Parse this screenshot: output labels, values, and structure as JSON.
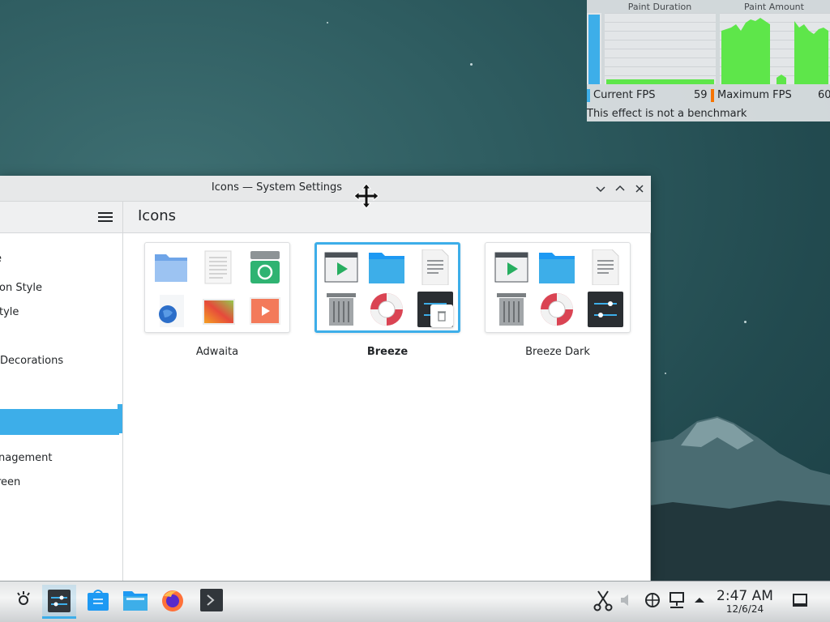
{
  "fps_overlay": {
    "paint_duration_label": "Paint Duration",
    "paint_amount_label": "Paint Amount",
    "current_fps_label": "Current FPS",
    "current_fps_value": "59",
    "maximum_fps_label": "Maximum FPS",
    "maximum_fps_value": "60",
    "note": "This effect is not a benchmark"
  },
  "window": {
    "title": "Icons — System Settings",
    "minimize_icon": "chevron-down-icon",
    "maximize_icon": "chevron-up-icon",
    "close_icon": "close-icon"
  },
  "sidebar": {
    "items": [
      {
        "label": "e"
      },
      {
        "label": "on Style"
      },
      {
        "label": "tyle"
      },
      {
        "label": "Decorations"
      },
      {
        "label": ""
      },
      {
        "label": "nagement"
      },
      {
        "label": "reen"
      }
    ]
  },
  "page": {
    "title": "Icons"
  },
  "themes": [
    {
      "name": "Adwaita",
      "selected": false
    },
    {
      "name": "Breeze",
      "selected": true
    },
    {
      "name": "Breeze Dark",
      "selected": false
    }
  ],
  "taskbar": {
    "time": "2:47 AM",
    "date": "12/6/24"
  },
  "colors": {
    "accent": "#3daee9",
    "fps_green": "#5ee64a",
    "max_fps_marker": "#f67400"
  }
}
